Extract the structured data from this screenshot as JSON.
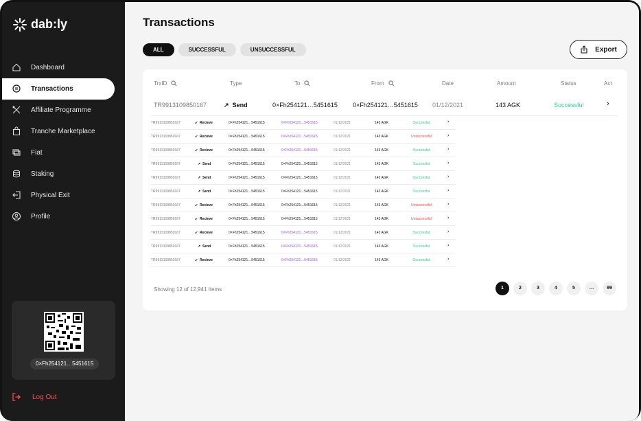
{
  "brand": {
    "name": "dab:ly"
  },
  "nav": [
    {
      "label": "Dashboard",
      "icon": "home-icon"
    },
    {
      "label": "Transactions",
      "icon": "transactions-icon",
      "active": true
    },
    {
      "label": "Affiliate Programme",
      "icon": "affiliate-icon"
    },
    {
      "label": "Tranche Marketplace",
      "icon": "shopping-bag-icon"
    },
    {
      "label": "Fiat",
      "icon": "fiat-icon"
    },
    {
      "label": "Staking",
      "icon": "staking-icon"
    },
    {
      "label": "Physical Exit",
      "icon": "exit-icon"
    },
    {
      "label": "Profile",
      "icon": "profile-icon"
    }
  ],
  "wallet": {
    "address": "0×Fh254121…5451615"
  },
  "logout_label": "Log Out",
  "page_title": "Transactions",
  "filters": [
    "ALL",
    "SUCCESSFUL",
    "UNSUCCESSFUL"
  ],
  "export_label": "Export",
  "columns": {
    "id": "TrxID",
    "type": "Type",
    "to": "To",
    "from": "From",
    "date": "Date",
    "amount": "Amount",
    "status": "Status",
    "act": "Act"
  },
  "featured_row": {
    "id": "TR9913109850167",
    "type": "Send",
    "to": "0×Fh254121…5451615",
    "from": "0×Fh254121…5451615",
    "date": "01/12/2021",
    "amount": "143 AGK",
    "status": "Successful"
  },
  "rows": [
    {
      "id": "TR9913109850167",
      "type": "Recieve",
      "to": "0×Fh254121…5451615",
      "from": "0×Fh254121…5451615",
      "date": "01/12/2021",
      "amount": "143 AGK",
      "status": "Successful",
      "from_purple": true
    },
    {
      "id": "TR9913109850167",
      "type": "Recieve",
      "to": "0×Fh254121…5451615",
      "from": "0×Fh254121…5451615",
      "date": "01/12/2021",
      "amount": "143 AGK",
      "status": "Unsuccessful",
      "from_purple": true
    },
    {
      "id": "TR9913109850167",
      "type": "Recieve",
      "to": "0×Fh254121…5451615",
      "from": "0×Fh254121…5451615",
      "date": "01/12/2021",
      "amount": "143 AGK",
      "status": "Successful",
      "from_purple": true
    },
    {
      "id": "TR9913109850167",
      "type": "Send",
      "to": "0×Fh254121…5451615",
      "from": "0×Fh254121…5451615",
      "date": "01/12/2021",
      "amount": "143 AGK",
      "status": "Successful",
      "from_purple": false
    },
    {
      "id": "TR9913109850167",
      "type": "Send",
      "to": "0×Fh254121…5451615",
      "from": "0×Fh254121…5451615",
      "date": "01/12/2021",
      "amount": "143 AGK",
      "status": "Successful",
      "from_purple": false
    },
    {
      "id": "TR9913109850167",
      "type": "Send",
      "to": "0×Fh254121…5451615",
      "from": "0×Fh254121…5451615",
      "date": "01/12/2021",
      "amount": "143 AGK",
      "status": "Successful",
      "from_purple": false
    },
    {
      "id": "TR9913109850167",
      "type": "Recieve",
      "to": "0×Fh254121…5451615",
      "from": "0×Fh254121…5451615",
      "date": "01/12/2021",
      "amount": "143 AGK",
      "status": "Unsuccessful",
      "from_purple": false
    },
    {
      "id": "TR9913109850167",
      "type": "Recieve",
      "to": "0×Fh254121…5451615",
      "from": "0×Fh254121…5451615",
      "date": "01/12/2021",
      "amount": "143 AGK",
      "status": "Unsuccessful",
      "from_purple": false
    },
    {
      "id": "TR9913109850167",
      "type": "Recieve",
      "to": "0×Fh254121…5451615",
      "from": "0×Fh254121…5451615",
      "date": "01/12/2021",
      "amount": "143 AGK",
      "status": "Successful",
      "from_purple": true
    },
    {
      "id": "TR9913109850167",
      "type": "Send",
      "to": "0×Fh254121…5451615",
      "from": "0×Fh254121…5451615",
      "date": "01/12/2021",
      "amount": "143 AGK",
      "status": "Successful",
      "from_purple": true
    },
    {
      "id": "TR9913109850167",
      "type": "Recieve",
      "to": "0×Fh254121…5451615",
      "from": "0×Fh254121…5451615",
      "date": "01/12/2021",
      "amount": "143 AGK",
      "status": "Successful",
      "from_purple": true
    }
  ],
  "showing": "Showing 12 of 12,941 Items",
  "pages": [
    "1",
    "2",
    "3",
    "4",
    "5",
    "…",
    "99"
  ],
  "colors": {
    "success": "#2ecc8f",
    "failure": "#ff4040",
    "purple": "#9b51e0",
    "logout": "#ff4d4d"
  }
}
